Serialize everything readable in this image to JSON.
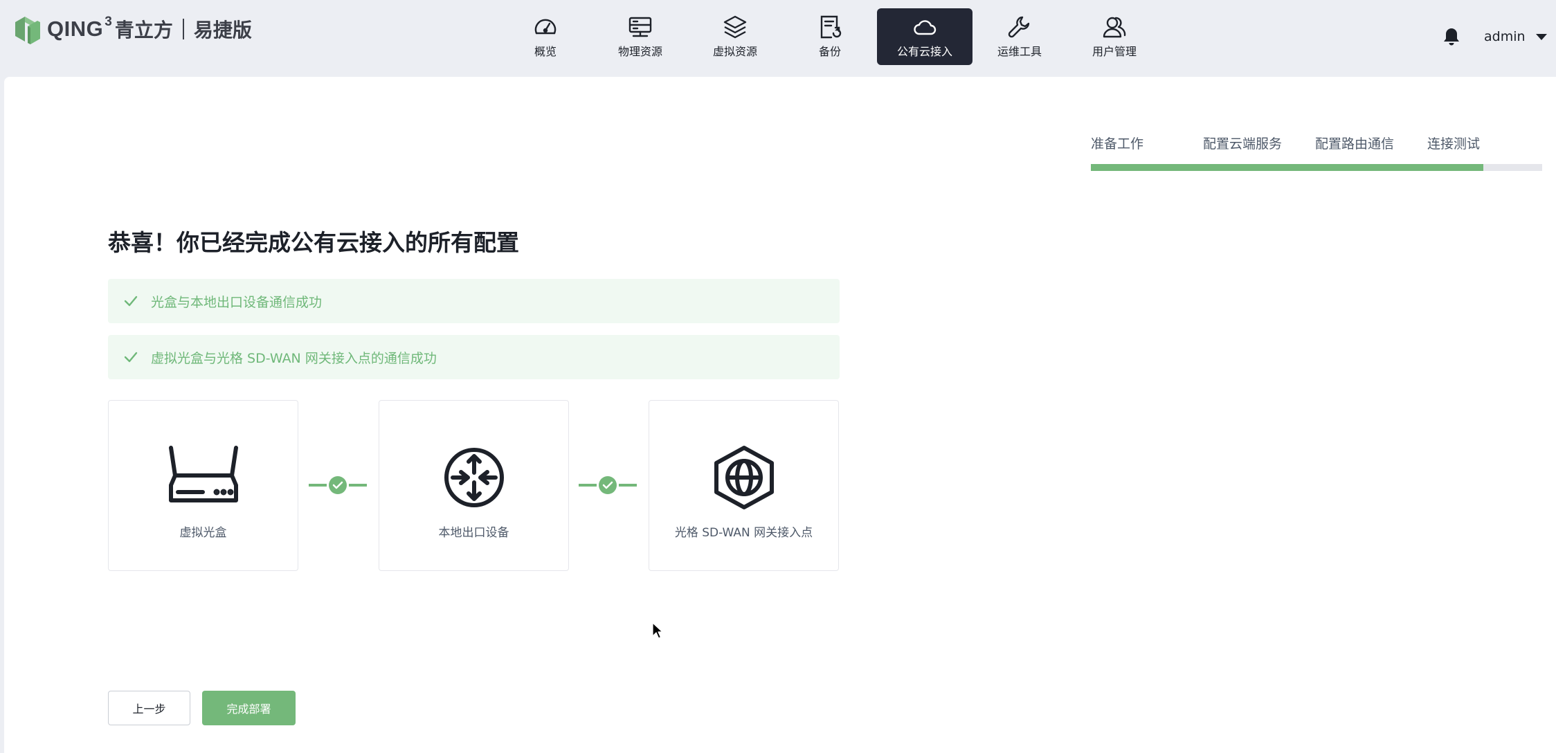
{
  "brand": {
    "wordmark": "QING",
    "superscript": "3",
    "name_cn": "青立方",
    "edition": "易捷版"
  },
  "nav": {
    "items": [
      {
        "label": "概览",
        "icon": "gauge-icon"
      },
      {
        "label": "物理资源",
        "icon": "server-icon"
      },
      {
        "label": "虚拟资源",
        "icon": "layers-icon"
      },
      {
        "label": "备份",
        "icon": "backup-icon"
      },
      {
        "label": "公有云接入",
        "icon": "cloud-icon",
        "active": true
      },
      {
        "label": "运维工具",
        "icon": "wrench-icon"
      },
      {
        "label": "用户管理",
        "icon": "users-icon"
      }
    ]
  },
  "header": {
    "username": "admin",
    "icons": [
      "bell-icon",
      "caret-down-icon"
    ]
  },
  "wizard": {
    "steps": [
      "准备工作",
      "配置云端服务",
      "配置路由通信",
      "连接测试"
    ],
    "progress_fraction": 0.87
  },
  "result": {
    "title": "恭喜！你已经完成公有云接入的所有配置",
    "checks": [
      "光盒与本地出口设备通信成功",
      "虚拟光盒与光格 SD-WAN 网关接入点的通信成功"
    ]
  },
  "topology": {
    "devices": [
      {
        "label": "虚拟光盒",
        "icon": "router-icon"
      },
      {
        "label": "本地出口设备",
        "icon": "gateway-icon"
      },
      {
        "label": "光格 SD-WAN 网关接入点",
        "icon": "globe-hex-icon"
      }
    ],
    "links": [
      "connected",
      "connected"
    ]
  },
  "actions": {
    "prev_label": "上一步",
    "finish_label": "完成部署"
  },
  "colors": {
    "accent_green": "#74b87a",
    "success_bg": "#f0f9f2",
    "nav_active_bg": "#232735",
    "page_bg": "#eceef3"
  }
}
